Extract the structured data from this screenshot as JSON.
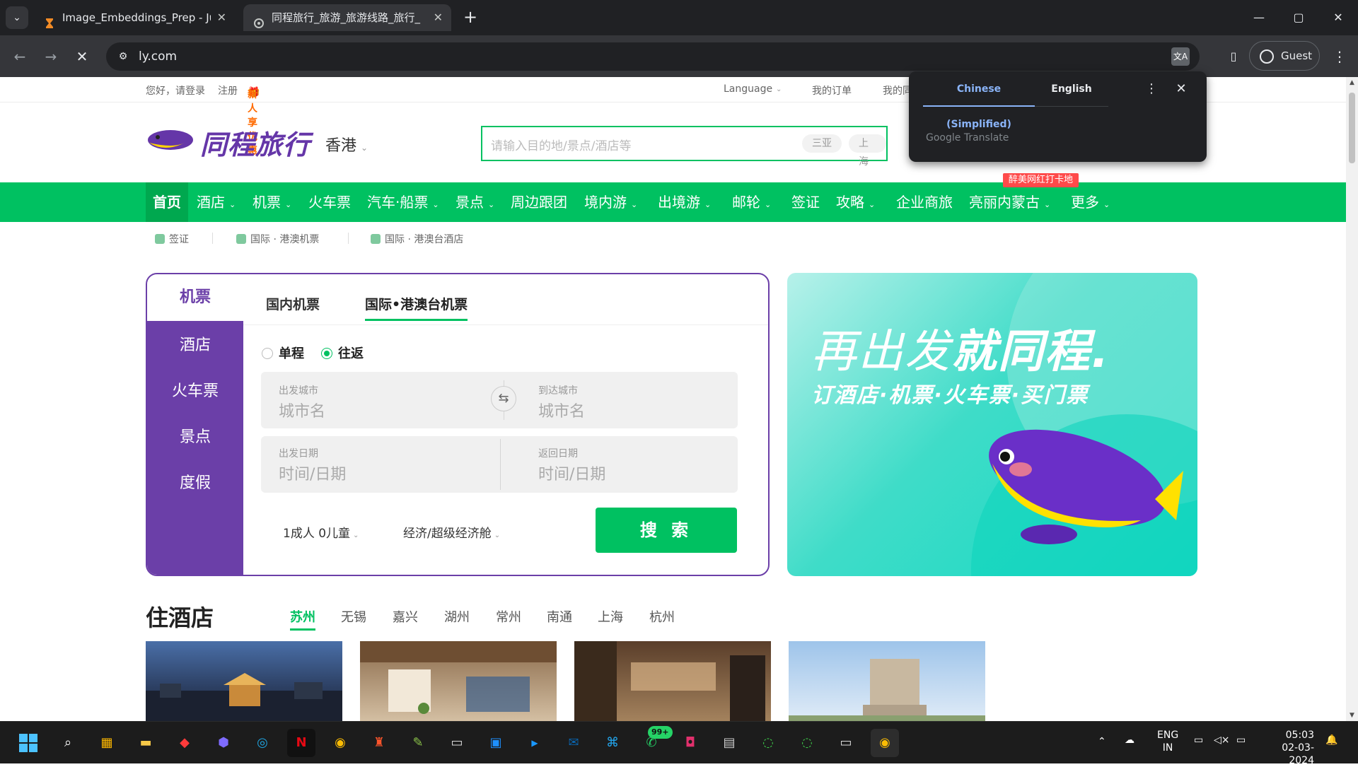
{
  "browser": {
    "tabs": [
      {
        "title": "Image_Embeddings_Prep - Jupy",
        "active": false
      },
      {
        "title": "同程旅行_旅游_旅游线路_旅行_",
        "active": true
      }
    ],
    "new_tab": "+",
    "url": "ly.com",
    "guest_label": "Guest",
    "window_controls": {
      "minimize": "—",
      "maximize": "▢",
      "close": "✕"
    }
  },
  "translate_popup": {
    "source_lang": "Chinese (Simplified)",
    "target_lang": "English",
    "brand": "Google Translate"
  },
  "site": {
    "topbar": {
      "greeting": "您好，请登录",
      "register": "注册",
      "new_user_offer": "新人享优惠",
      "language": "Language",
      "my_orders": "我的订单",
      "my_more": "我的同"
    },
    "logo_text": "同程旅行",
    "city": "香港",
    "search": {
      "placeholder": "请输入目的地/景点/酒店等",
      "hot_tags": [
        "三亚",
        "上海"
      ]
    },
    "nav": [
      {
        "label": "首页",
        "dropdown": false,
        "active": true
      },
      {
        "label": "酒店",
        "dropdown": true
      },
      {
        "label": "机票",
        "dropdown": true
      },
      {
        "label": "火车票",
        "dropdown": false
      },
      {
        "label": "汽车·船票",
        "dropdown": true
      },
      {
        "label": "景点",
        "dropdown": true
      },
      {
        "label": "周边跟团",
        "dropdown": false
      },
      {
        "label": "境内游",
        "dropdown": true
      },
      {
        "label": "出境游",
        "dropdown": true
      },
      {
        "label": "邮轮",
        "dropdown": true
      },
      {
        "label": "签证",
        "dropdown": false
      },
      {
        "label": "攻略",
        "dropdown": true
      },
      {
        "label": "企业商旅",
        "dropdown": false
      },
      {
        "label": "亮丽内蒙古",
        "dropdown": true
      },
      {
        "label": "更多",
        "dropdown": true
      }
    ],
    "promo_badge": "醉美网红打卡地",
    "subnav": [
      "签证",
      "国际 · 港澳机票",
      "国际 · 港澳台酒店"
    ],
    "booking": {
      "side_tabs": [
        "机票",
        "酒店",
        "火车票",
        "景点",
        "度假"
      ],
      "tabs": [
        "国内机票",
        "国际•港澳台机票"
      ],
      "active_tab": 1,
      "trip_types": [
        "单程",
        "往返"
      ],
      "selected_trip": 1,
      "depart_city_label": "出发城市",
      "depart_city_placeholder": "城市名",
      "arrive_city_label": "到达城市",
      "arrive_city_placeholder": "城市名",
      "depart_date_label": "出发日期",
      "depart_date_placeholder": "时间/日期",
      "return_date_label": "返回日期",
      "return_date_placeholder": "时间/日期",
      "passengers": "1成人 0儿童",
      "cabin": "经济/超级经济舱",
      "search_button": "搜 索"
    },
    "banner": {
      "slogan_a": "再出发",
      "slogan_b": "就同程.",
      "subline": "订酒店·机票·火车票·买门票"
    },
    "hotels": {
      "title": "住酒店",
      "cities": [
        "苏州",
        "无锡",
        "嘉兴",
        "湖州",
        "常州",
        "南通",
        "上海",
        "杭州"
      ],
      "active_city": 0
    }
  },
  "taskbar": {
    "whatsapp_badge": "99+",
    "lang_line1": "ENG",
    "lang_line2": "IN",
    "time": "05:03",
    "date": "02-03-2024"
  },
  "colors": {
    "brand_green": "#00c161",
    "brand_purple": "#6b3fa8",
    "chrome_dark": "#202124"
  }
}
